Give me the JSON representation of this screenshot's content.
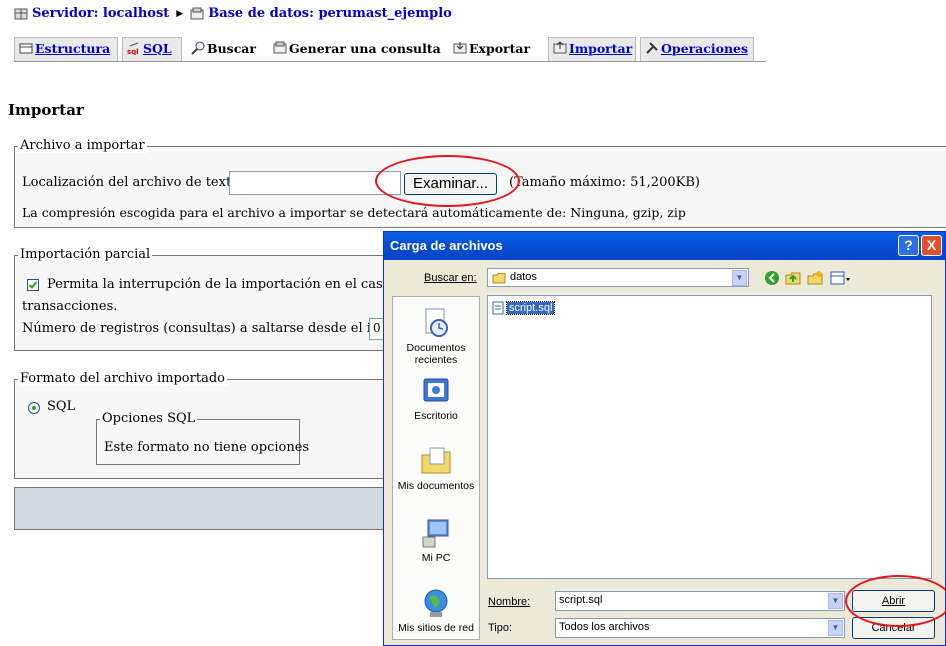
{
  "breadcrumb": {
    "server": "Servidor: localhost",
    "database": "Base de datos: perumast_ejemplo"
  },
  "tabs": [
    {
      "label": "Estructura",
      "icon": "structure-icon"
    },
    {
      "label": "SQL",
      "icon": "sql-icon"
    },
    {
      "label": "Buscar",
      "icon": "search-icon"
    },
    {
      "label": "Generar una consulta",
      "icon": "query-icon"
    },
    {
      "label": "Exportar",
      "icon": "export-icon"
    },
    {
      "label": "Importar",
      "icon": "import-icon"
    },
    {
      "label": "Operaciones",
      "icon": "operations-icon"
    }
  ],
  "page_title": "Importar",
  "import_file": {
    "legend": "Archivo a importar",
    "location_label": "Localización del archivo de texto",
    "browse_button": "Examinar...",
    "max_size": "(Tamaño máximo: 51,200KB)",
    "compression_note": "La compresión escogida para el archivo a importar se detectará automáticamente de: Ninguna, gzip, zip"
  },
  "partial_import": {
    "legend": "Importación parcial",
    "allow_interrupt": "Permita la interrupción de la importación en el caso de q",
    "allow_interrupt_cont": "transacciones.",
    "skip_label": "Número de registros (consultas) a saltarse desde el inicio",
    "skip_value": "0"
  },
  "format": {
    "legend": "Formato del archivo importado",
    "sql_label": "SQL",
    "options_legend": "Opciones SQL",
    "options_text": "Este formato no tiene opciones"
  },
  "dialog": {
    "title": "Carga de archivos",
    "look_in_label": "Buscar en:",
    "look_in_value": "datos",
    "places": [
      {
        "label": "Documentos recientes",
        "icon": "recent-documents-icon"
      },
      {
        "label": "Escritorio",
        "icon": "desktop-icon"
      },
      {
        "label": "Mis documentos",
        "icon": "my-documents-icon"
      },
      {
        "label": "Mi PC",
        "icon": "my-computer-icon"
      },
      {
        "label": "Mis sitios de red",
        "icon": "network-places-icon"
      }
    ],
    "files": [
      "script.sql"
    ],
    "filename_label": "Nombre:",
    "filename_value": "script.sql",
    "filetype_label": "Tipo:",
    "filetype_value": "Todos los archivos",
    "open_button": "Abrir",
    "cancel_button": "Cancelar",
    "help_button": "?",
    "close_button": "X"
  },
  "colors": {
    "link": "#0000cc",
    "highlight_circle": "#e8141e",
    "dialog_titlebar": "#0450d8"
  }
}
